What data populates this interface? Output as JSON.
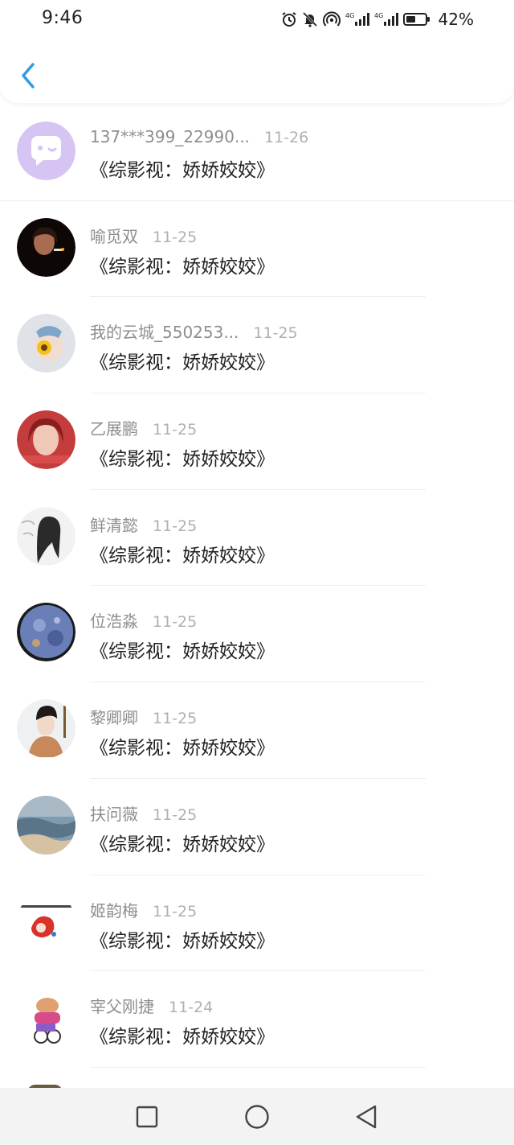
{
  "status_bar": {
    "time": "9:46",
    "battery_percent": "42%",
    "icons": [
      "alarm-icon",
      "mute-icon",
      "hotspot-icon",
      "signal-4g-icon",
      "signal-4g-icon",
      "battery-icon"
    ]
  },
  "header": {
    "back_icon": "chevron-left-icon",
    "accent_color": "#2d9ae8"
  },
  "comments": [
    {
      "name": "137***399_22990...",
      "date": "11-26",
      "message": "《综影视：娇娇姣姣》",
      "avatar": "default-chat-avatar"
    },
    {
      "name": "喻觅双",
      "date": "11-25",
      "message": "《综影视：娇娇姣姣》",
      "avatar": "user-photo-avatar"
    },
    {
      "name": "我的云城_550253...",
      "date": "11-25",
      "message": "《综影视：娇娇姣姣》",
      "avatar": "user-photo-avatar"
    },
    {
      "name": "乙展鹏",
      "date": "11-25",
      "message": "《综影视：娇娇姣姣》",
      "avatar": "user-photo-avatar"
    },
    {
      "name": "鲜清懿",
      "date": "11-25",
      "message": "《综影视：娇娇姣姣》",
      "avatar": "user-photo-avatar"
    },
    {
      "name": "位浩淼",
      "date": "11-25",
      "message": "《综影视：娇娇姣姣》",
      "avatar": "user-photo-avatar"
    },
    {
      "name": "黎卿卿",
      "date": "11-25",
      "message": "《综影视：娇娇姣姣》",
      "avatar": "user-photo-avatar"
    },
    {
      "name": "扶问薇",
      "date": "11-25",
      "message": "《综影视：娇娇姣姣》",
      "avatar": "user-photo-avatar"
    },
    {
      "name": "姬韵梅",
      "date": "11-25",
      "message": "《综影视：娇娇姣姣》",
      "avatar": "user-photo-avatar"
    },
    {
      "name": "宰父刚捷",
      "date": "11-24",
      "message": "《综影视：娇娇姣姣》",
      "avatar": "user-photo-avatar"
    }
  ],
  "nav_bar": {
    "recent_icon": "square-icon",
    "home_icon": "circle-icon",
    "back_icon": "triangle-back-icon"
  }
}
